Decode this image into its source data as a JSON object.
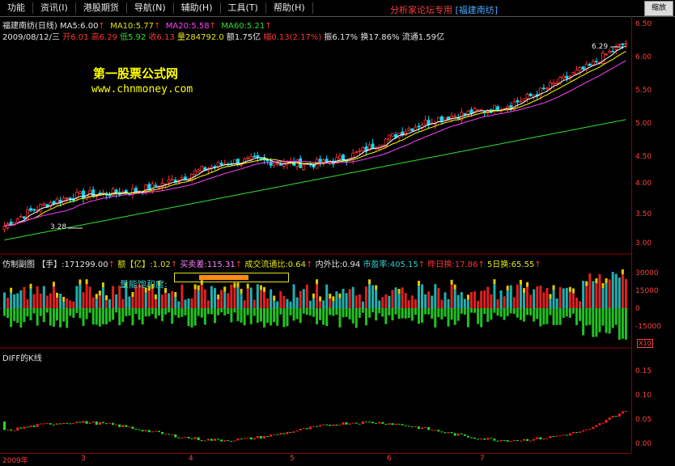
{
  "menu": {
    "items": [
      "功能",
      "资讯(I)",
      "港股期货",
      "导航(N)",
      "辅助(H)",
      "工具(T)",
      "帮助(H)"
    ],
    "forum": "分析家论坛专用",
    "stock_tag": "[福建南纺]",
    "window_button": "缩放"
  },
  "header": {
    "name_ma": "福建南纺(日线) MA5:6.00",
    "ma10": "MA10:5.77",
    "ma20": "MA20:5.58",
    "ma60": "MA60:5.21",
    "date": "2009/08/12/三",
    "open": "开6.01",
    "high": "高6.29",
    "low": "低5.92",
    "close": "收6.13",
    "vol": "量284792.0",
    "amount": "额1.75亿",
    "change": "幅0.13(2.17%)",
    "amplitude": "振6.17%",
    "turnover": "换17.86%",
    "float": "流通1.59亿"
  },
  "watermark": {
    "line1": "第一股票公式网",
    "line2": "www.chnmoney.com"
  },
  "price_axis": [
    "6.50",
    "6.00",
    "5.50",
    "5.00",
    "4.50",
    "4.00",
    "3.50",
    "3.00"
  ],
  "price_annotations": {
    "high": "6.29",
    "low": "3.28"
  },
  "sub_indicator": {
    "title": "仿制副图",
    "hand": "【手】:171299.00",
    "amt": "额【亿】:1.02",
    "diff_buy_sell": "买卖差:115.31",
    "deal_ratio": "成交流通比:0.64",
    "in_out": "内外比:0.94",
    "pe": "市盈率:405.15",
    "day_turn": "昨日换:17.86",
    "five_turn": "5日换:65.55",
    "saturation_label": "量能饱和度:",
    "saturation_percent": 55
  },
  "vol_axis": [
    "30000",
    "15000",
    "0",
    "-15000"
  ],
  "vol_unit": "X10",
  "diff_panel": {
    "title": "DIFF的K线",
    "axis": [
      "0.15",
      "0.10",
      "0.05",
      "0.00"
    ]
  },
  "x_axis": [
    "2009年",
    "3",
    "4",
    "5",
    "6",
    "7"
  ],
  "colors": {
    "up": "#ff3333",
    "down": "#00e0ff",
    "ma5": "#ffffff",
    "ma10": "#ffff00",
    "ma20": "#ff40ff",
    "ma60": "#33dd33"
  }
}
